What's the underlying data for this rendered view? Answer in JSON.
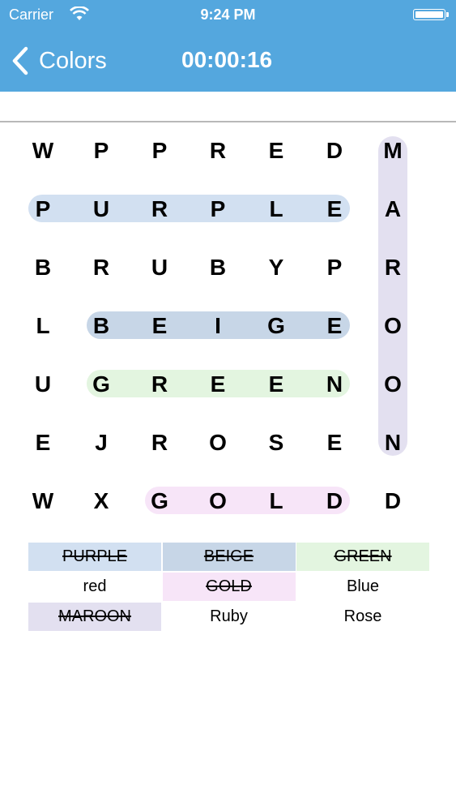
{
  "status_bar": {
    "carrier": "Carrier",
    "time": "9:24 PM"
  },
  "nav": {
    "back_label": "Colors",
    "timer": "00:00:16"
  },
  "grid": {
    "rows": [
      [
        "W",
        "P",
        "P",
        "R",
        "E",
        "D",
        "M"
      ],
      [
        "P",
        "U",
        "R",
        "P",
        "L",
        "E",
        "A"
      ],
      [
        "B",
        "R",
        "U",
        "B",
        "Y",
        "P",
        "R"
      ],
      [
        "L",
        "B",
        "E",
        "I",
        "G",
        "E",
        "O"
      ],
      [
        "U",
        "G",
        "R",
        "E",
        "E",
        "N",
        "O"
      ],
      [
        "E",
        "J",
        "R",
        "O",
        "S",
        "E",
        "N"
      ],
      [
        "W",
        "X",
        "G",
        "O",
        "L",
        "D",
        "D"
      ]
    ]
  },
  "word_list": [
    {
      "word": "PURPLE",
      "found": true,
      "color": "#d2e0f1"
    },
    {
      "word": "BEIGE",
      "found": true,
      "color": "#c7d6e7"
    },
    {
      "word": "GREEN",
      "found": true,
      "color": "#e3f5e0"
    },
    {
      "word": "red",
      "found": false,
      "color": "#ffffff"
    },
    {
      "word": "GOLD",
      "found": true,
      "color": "#f7e5f8"
    },
    {
      "word": "Blue",
      "found": false,
      "color": "#ffffff"
    },
    {
      "word": "MAROON",
      "found": true,
      "color": "#e3e0f0"
    },
    {
      "word": "Ruby",
      "found": false,
      "color": "#ffffff"
    },
    {
      "word": "Rose",
      "found": false,
      "color": "#ffffff"
    }
  ],
  "colors": {
    "nav_bar": "#54a7de"
  }
}
